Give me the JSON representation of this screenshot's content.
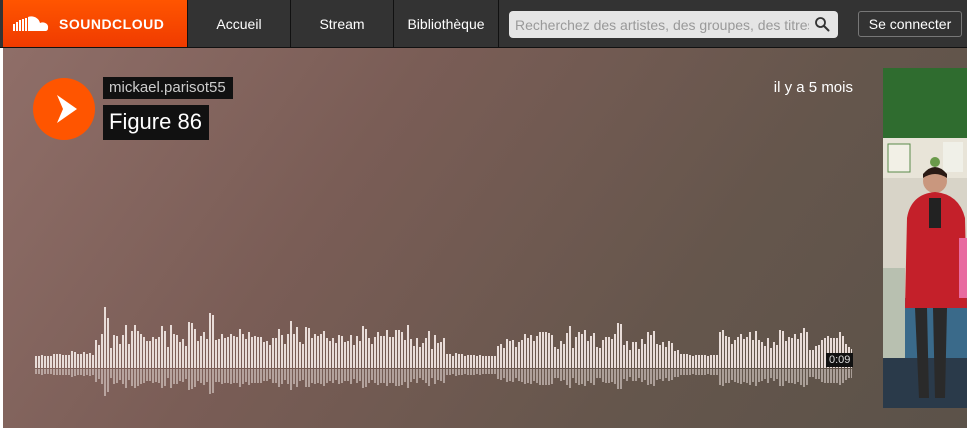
{
  "header": {
    "logo_text": "SOUNDCLOUD",
    "nav": [
      "Accueil",
      "Stream",
      "Bibliothèque"
    ],
    "search_placeholder": "Recherchez des artistes, des groupes, des titres",
    "signin_label": "Se connecter"
  },
  "track": {
    "user": "mickael.parisot55",
    "title": "Figure 86",
    "posted": "il y a 5 mois",
    "duration": "0:09",
    "waveform": [
      12,
      12,
      13,
      12,
      12,
      12,
      14,
      14,
      14,
      13,
      13,
      13,
      17,
      16,
      14,
      14,
      16,
      14,
      15,
      13,
      28,
      23,
      34,
      61,
      50,
      20,
      33,
      32,
      24,
      33,
      43,
      24,
      37,
      43,
      37,
      34,
      31,
      27,
      27,
      31,
      29,
      31,
      42,
      37,
      21,
      43,
      34,
      33,
      26,
      29,
      22,
      46,
      45,
      39,
      27,
      32,
      36,
      29,
      55,
      53,
      28,
      29,
      34,
      30,
      31,
      34,
      32,
      31,
      39,
      34,
      29,
      36,
      31,
      32,
      31,
      31,
      26,
      27,
      23,
      30,
      30,
      39,
      33,
      24,
      34,
      47,
      34,
      41,
      26,
      24,
      41,
      40,
      30,
      34,
      32,
      34,
      37,
      30,
      27,
      30,
      25,
      33,
      32,
      26,
      27,
      33,
      23,
      32,
      27,
      42,
      39,
      30,
      24,
      31,
      36,
      32,
      32,
      38,
      31,
      31,
      38,
      38,
      36,
      28,
      43,
      29,
      22,
      30,
      21,
      25,
      30,
      37,
      19,
      33,
      25,
      26,
      30,
      14,
      14,
      12,
      15,
      14,
      14,
      12,
      13,
      13,
      13,
      12,
      13,
      12,
      12,
      12,
      12,
      12,
      22,
      24,
      20,
      29,
      27,
      28,
      21,
      26,
      28,
      34,
      30,
      33,
      27,
      32,
      36,
      36,
      36,
      35,
      33,
      21,
      19,
      27,
      24,
      35,
      42,
      20,
      31,
      36,
      34,
      38,
      27,
      32,
      35,
      21,
      20,
      28,
      31,
      31,
      29,
      34,
      45,
      44,
      23,
      27,
      18,
      26,
      26,
      19,
      29,
      24,
      36,
      33,
      37,
      24,
      23,
      26,
      21,
      27,
      25,
      17,
      18,
      14,
      14,
      14,
      13,
      12,
      13,
      13,
      13,
      13,
      12,
      13,
      13,
      13,
      36,
      38,
      32,
      31,
      24,
      28,
      31,
      34,
      29,
      31,
      36,
      28,
      37,
      28,
      26,
      22,
      30,
      20,
      26,
      23,
      38,
      37,
      27,
      31,
      30,
      34,
      29,
      35,
      40,
      36,
      18,
      18,
      22,
      23,
      28,
      30,
      32,
      30,
      30,
      30,
      36,
      32,
      24,
      21,
      19,
      29,
      27,
      30,
      20,
      21,
      23,
      20,
      16,
      22,
      24,
      20,
      15,
      17,
      19,
      17,
      18,
      16,
      17,
      12,
      14,
      12,
      12,
      13,
      12,
      12,
      12,
      12,
      12,
      12,
      12,
      12,
      12,
      12,
      12,
      12,
      12
    ],
    "colors": {
      "accent": "#ff5500",
      "wave": "#e8dcd8"
    }
  }
}
